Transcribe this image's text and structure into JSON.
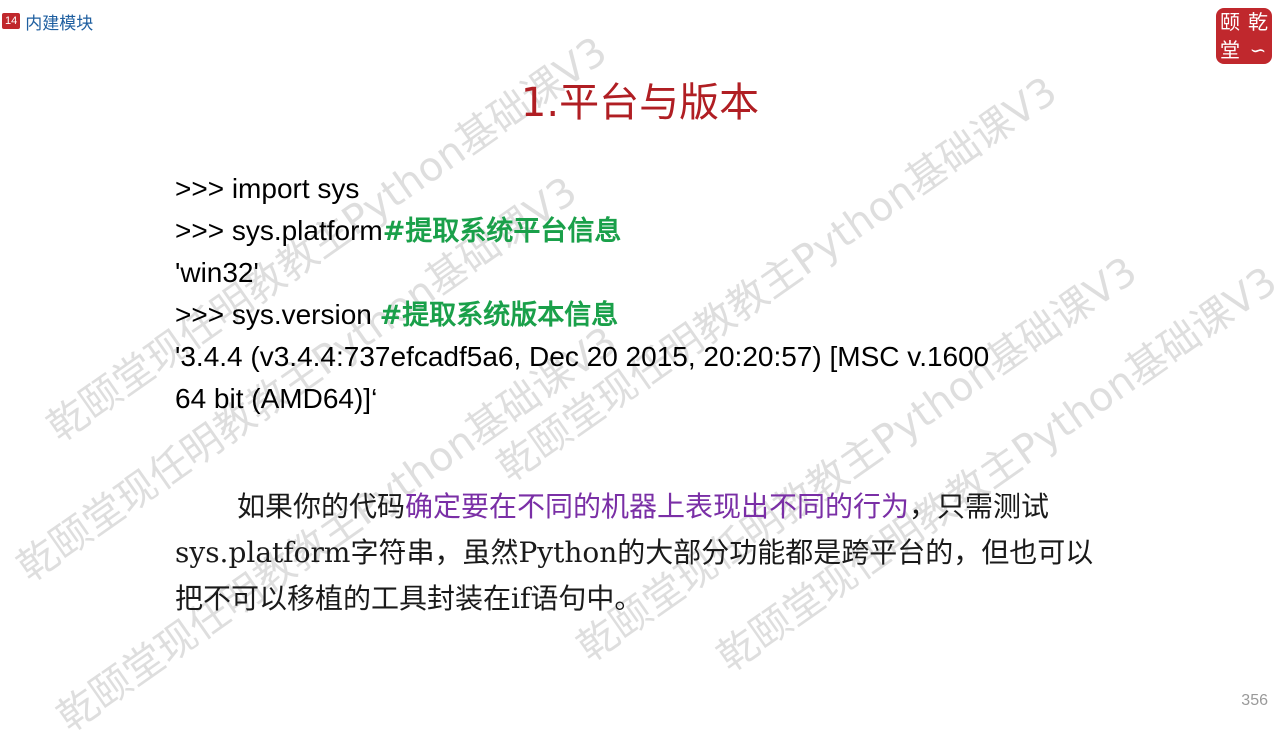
{
  "header": {
    "chapter_number": "14",
    "chapter_title": "内建模块"
  },
  "logo": {
    "chars": [
      "颐",
      "乾",
      "堂",
      "∽"
    ]
  },
  "slide": {
    "title": "1.平台与版本"
  },
  "code": {
    "line1": ">>> import sys",
    "line2_code": ">>> sys.platform",
    "line2_comment": "#提取系统平台信息",
    "line3": "'win32'",
    "line4_code": ">>> sys.version ",
    "line4_comment": "#提取系统版本信息",
    "line5": "'3.4.4 (v3.4.4:737efcadf5a6, Dec 20 2015, 20:20:57) [MSC v.1600",
    "line6": "64 bit (AMD64)]‘"
  },
  "paragraph": {
    "part1": "如果你的代码",
    "highlight": "确定要在不同的机器上表现出不同的行为",
    "part2": "，只需测试sys.platform字符串，虽然Python的大部分功能都是跨平台的，但也可以把不可以移植的工具封装在if语句中。"
  },
  "watermark": {
    "text": "乾颐堂现任明教教主Python基础课V3"
  },
  "page_number": "356",
  "colors": {
    "title": "#b01e23",
    "comment": "#1aa04a",
    "highlight": "#7a2fa6",
    "header": "#1f5fa0",
    "badge": "#c0282d"
  }
}
